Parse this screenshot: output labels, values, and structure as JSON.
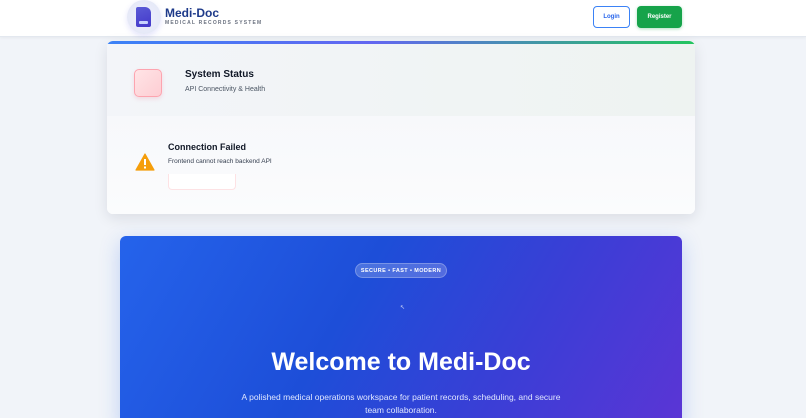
{
  "header": {
    "brand": "Medi-Doc",
    "tagline": "MEDICAL RECORDS SYSTEM",
    "login_label": "Login",
    "register_label": "Register",
    "logo_icon": "document-icon"
  },
  "status_card": {
    "title": "System Status",
    "subtitle": "API Connectivity & Health",
    "status_icon": "server-status-icon",
    "connection": {
      "title": "Connection Failed",
      "message": "Frontend cannot reach backend API",
      "icon": "warning-icon"
    }
  },
  "hero": {
    "badge": "SECURE • FAST • MODERN",
    "cursor_glyph": "↖",
    "title": "Welcome to Medi-Doc",
    "description": "A polished medical operations workspace for patient records, scheduling, and secure team collaboration."
  },
  "colors": {
    "brand_blue": "#1e3a8a",
    "login_border": "#3b82f6",
    "register_green": "#16a34a",
    "hero_start": "#2563eb",
    "hero_end": "#5b35d5",
    "warning_amber": "#f59e0b"
  }
}
